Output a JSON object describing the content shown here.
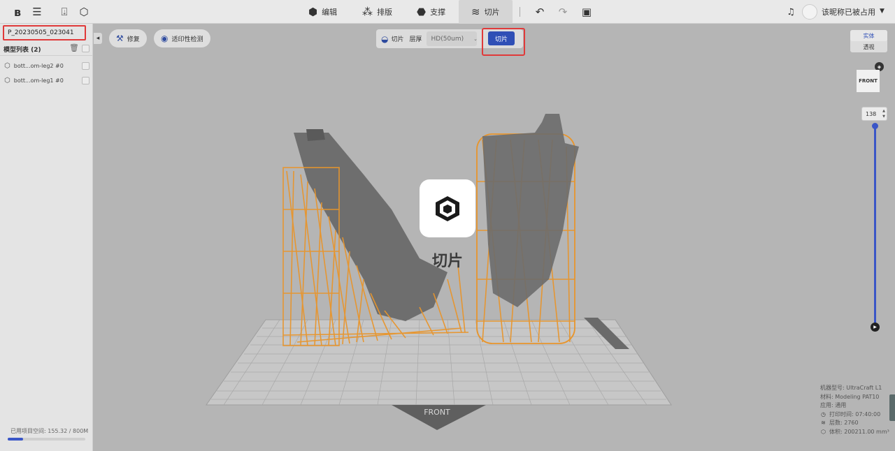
{
  "topbar": {
    "tabs": [
      {
        "label": "编辑",
        "icon": "edit-icon"
      },
      {
        "label": "排版",
        "icon": "arrange-icon"
      },
      {
        "label": "支撑",
        "icon": "support-icon"
      },
      {
        "label": "切片",
        "icon": "slice-icon"
      }
    ],
    "active_tab": "切片",
    "username": "该昵称已被占用"
  },
  "left_panel": {
    "project_name": "P_20230505_023041",
    "model_list_title": "模型列表 (2)",
    "models": [
      {
        "name": "bott...om-leg2 #0"
      },
      {
        "name": "bott...om-leg1 #0"
      }
    ],
    "storage_label": "已用项目空间: 155.32 / 800M",
    "storage_fraction": 0.194
  },
  "toolbar": {
    "repair_label": "修复",
    "printability_label": "适印性检测",
    "slice_label": "切片",
    "layer_thickness_label": "层厚",
    "layer_thickness_value": "HD(50um)",
    "slice_button_label": "切片"
  },
  "view": {
    "solid_label": "实体",
    "perspective_label": "透视",
    "nav_cube_face": "FRONT",
    "layer_value": "138",
    "plate_front_label": "FRONT"
  },
  "info": {
    "machine": "机器型号: UltraCraft L1",
    "material": "材料: Modeling PAT10",
    "application": "应用: 通用",
    "print_time": "打印时间: 07:40:00",
    "layers": "层数: 2760",
    "volume": "体积: 200211.00 mm³"
  },
  "overlay": {
    "label": "切片"
  },
  "colors": {
    "accent": "#2f4fb6",
    "support": "#e8952c",
    "highlight": "#e03a3a"
  }
}
